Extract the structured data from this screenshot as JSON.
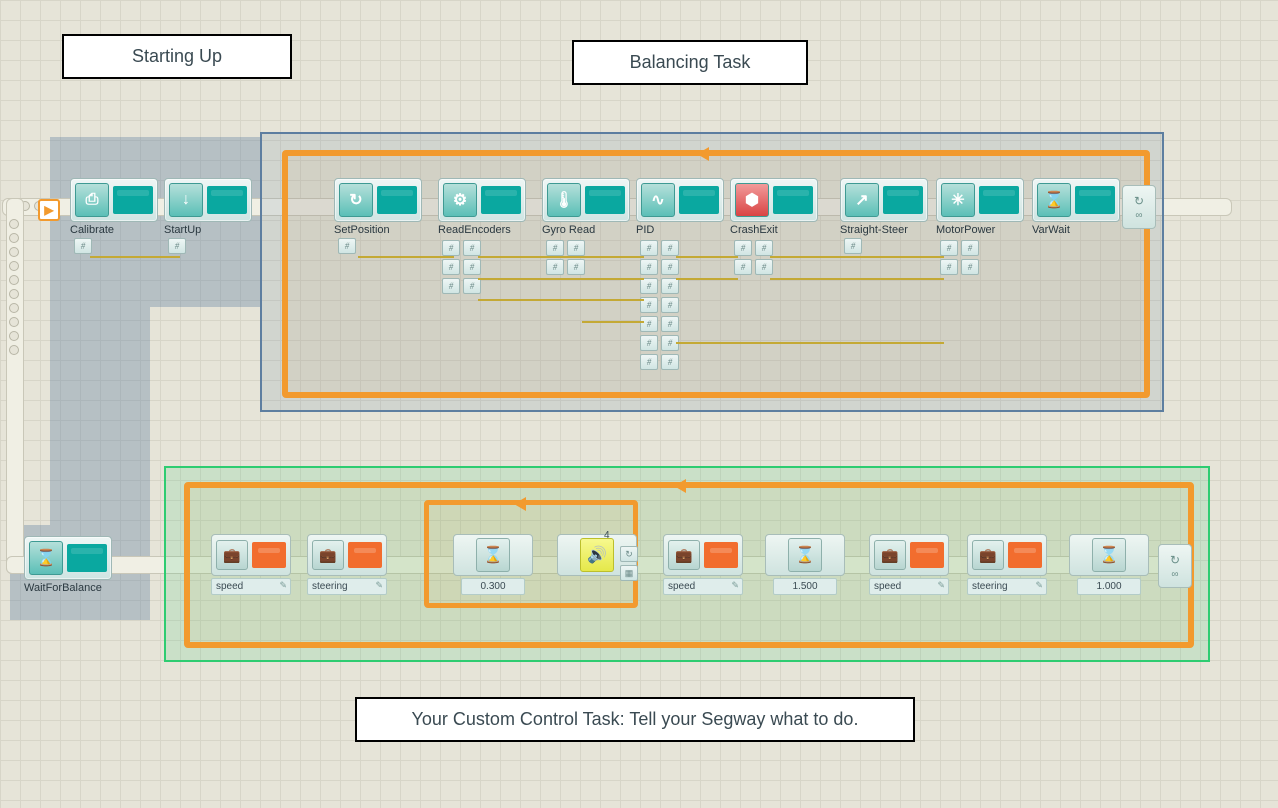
{
  "labels": {
    "startingUp": "Starting Up",
    "balancing": "Balancing Task",
    "custom": "Your Custom Control Task: Tell your Segway what to do."
  },
  "startup_blocks": [
    {
      "name": "Calibrate",
      "icon": "⎙"
    },
    {
      "name": "StartUp",
      "icon": "↓"
    }
  ],
  "balancing_blocks": [
    {
      "name": "SetPosition",
      "icon": "↻"
    },
    {
      "name": "ReadEncoders",
      "icon": "⚙"
    },
    {
      "name": "Gyro Read",
      "icon": "🌡"
    },
    {
      "name": "PID",
      "icon": "∿"
    },
    {
      "name": "CrashExit",
      "icon": "⬢"
    },
    {
      "name": "Straight-Steer",
      "icon": "↗"
    },
    {
      "name": "MotorPower",
      "icon": "✳"
    },
    {
      "name": "VarWait",
      "icon": "⌛"
    }
  ],
  "wait_block": {
    "name": "WaitForBalance",
    "icon": "⌛"
  },
  "control_row": [
    {
      "type": "suitcase",
      "label": "speed"
    },
    {
      "type": "suitcase",
      "label": "steering"
    },
    {
      "type": "value",
      "label": "0.300",
      "icon": "⌛"
    },
    {
      "type": "sound",
      "icon": "🔊",
      "count": "4"
    },
    {
      "type": "suitcase",
      "label": "speed"
    },
    {
      "type": "value",
      "label": "1.500",
      "icon": "⌛"
    },
    {
      "type": "suitcase",
      "label": "speed"
    },
    {
      "type": "suitcase",
      "label": "steering"
    },
    {
      "type": "value",
      "label": "1.000",
      "icon": "⌛"
    }
  ]
}
